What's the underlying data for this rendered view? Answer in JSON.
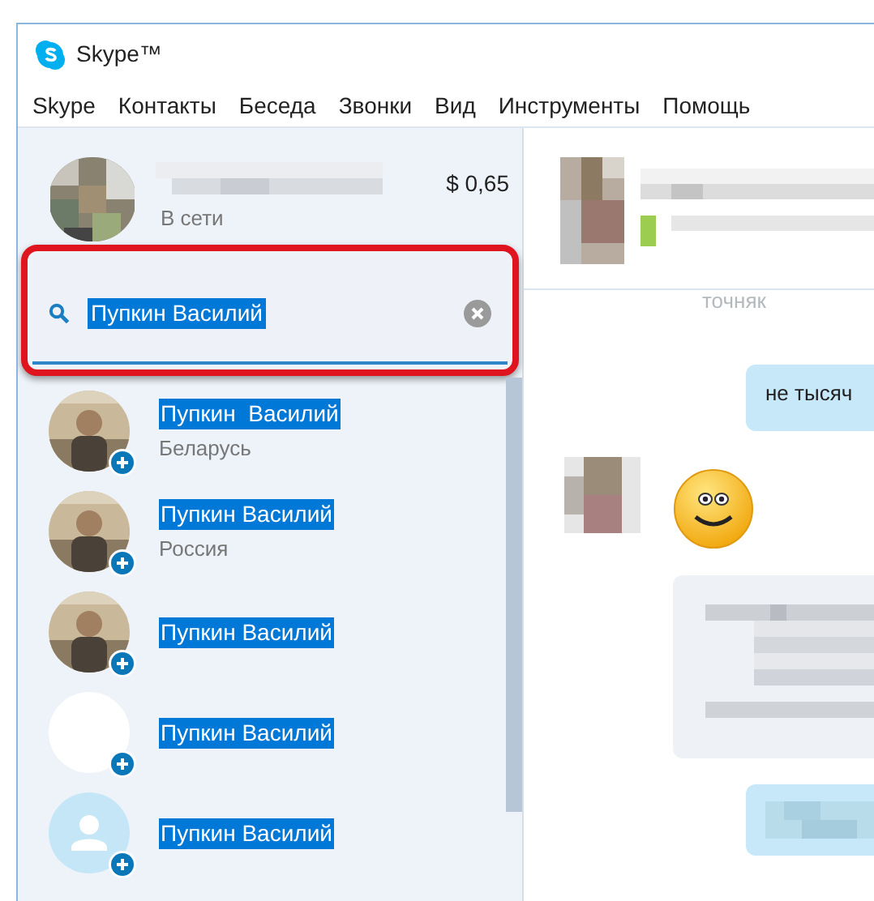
{
  "window": {
    "title": "Skype™"
  },
  "menu": [
    "Skype",
    "Контакты",
    "Беседа",
    "Звонки",
    "Вид",
    "Инструменты",
    "Помощь"
  ],
  "profile": {
    "balance": "$ 0,65",
    "status": "В сети"
  },
  "search": {
    "value": "Пупкин Василий",
    "text_selected": true
  },
  "contacts": [
    {
      "name": "Пупкин  Василий",
      "subtitle": "Беларусь",
      "highlighted": true
    },
    {
      "name": "Пупкин Василий",
      "subtitle": "Россия",
      "highlighted": true
    },
    {
      "name": "Пупкин Василий",
      "highlighted": true
    },
    {
      "name": "Пупкин Василий",
      "kind": "blank",
      "highlighted": true
    },
    {
      "name": "Пупкин Василий",
      "kind": "default",
      "highlighted": true
    }
  ],
  "chat": {
    "faded_text": "точняк",
    "messages": [
      {
        "kind": "outgoing",
        "text": "не тысяч"
      },
      {
        "kind": "emoji"
      },
      {
        "kind": "incoming_blurred"
      },
      {
        "kind": "outgoing_blurred"
      }
    ]
  }
}
